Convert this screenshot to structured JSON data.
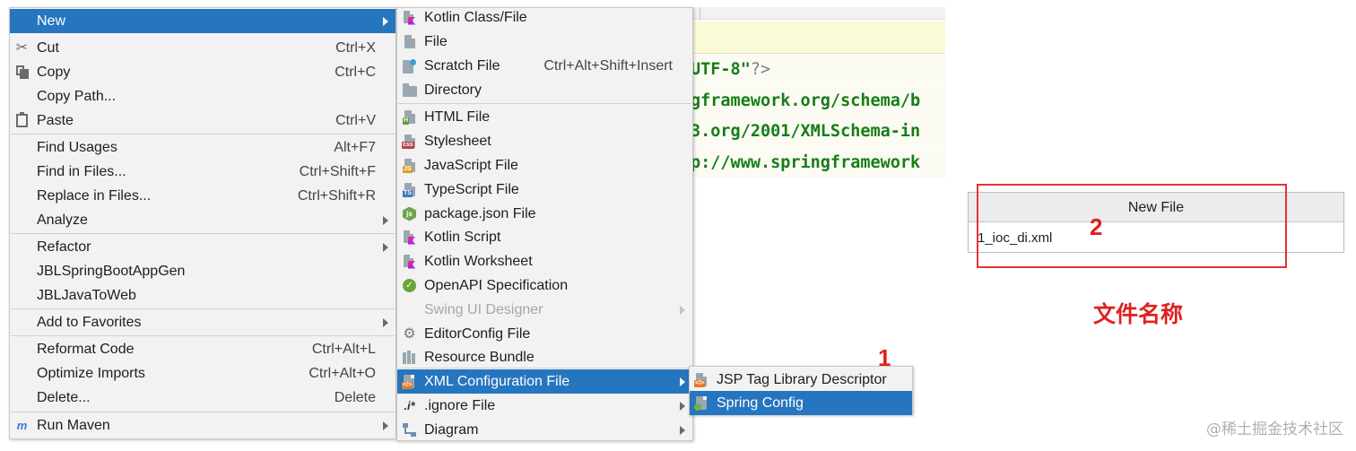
{
  "editor": {
    "lines": [
      {
        "text": "UTF-8\"",
        "tail": "?>"
      },
      {
        "text": "gframework.org/schema/b",
        "tail": ""
      },
      {
        "text": "3.org/2001/XMLSchema-in",
        "tail": ""
      },
      {
        "text": "p://www.springframework",
        "tail": ""
      }
    ]
  },
  "context_menu": {
    "items": [
      {
        "label": "New",
        "shortcut": "",
        "submenu": true,
        "selected": true,
        "icon": ""
      },
      {
        "label": "Cut",
        "shortcut": "Ctrl+X",
        "icon": "scissors-icon"
      },
      {
        "label": "Copy",
        "shortcut": "Ctrl+C",
        "icon": "copy-icon"
      },
      {
        "label": "Copy Path...",
        "shortcut": "",
        "icon": ""
      },
      {
        "label": "Paste",
        "shortcut": "Ctrl+V",
        "icon": "clipboard-icon"
      },
      {
        "label": "Find Usages",
        "shortcut": "Alt+F7",
        "icon": ""
      },
      {
        "label": "Find in Files...",
        "shortcut": "Ctrl+Shift+F",
        "icon": ""
      },
      {
        "label": "Replace in Files...",
        "shortcut": "Ctrl+Shift+R",
        "icon": ""
      },
      {
        "label": "Analyze",
        "shortcut": "",
        "submenu": true,
        "icon": ""
      },
      {
        "label": "Refactor",
        "shortcut": "",
        "submenu": true,
        "icon": ""
      },
      {
        "label": "JBLSpringBootAppGen",
        "shortcut": "",
        "icon": ""
      },
      {
        "label": "JBLJavaToWeb",
        "shortcut": "",
        "icon": ""
      },
      {
        "label": "Add to Favorites",
        "shortcut": "",
        "submenu": true,
        "icon": ""
      },
      {
        "label": "Reformat Code",
        "shortcut": "Ctrl+Alt+L",
        "icon": ""
      },
      {
        "label": "Optimize Imports",
        "shortcut": "Ctrl+Alt+O",
        "icon": ""
      },
      {
        "label": "Delete...",
        "shortcut": "Delete",
        "icon": ""
      },
      {
        "label": "Run Maven",
        "shortcut": "",
        "submenu": true,
        "icon": "maven-icon"
      }
    ]
  },
  "new_menu": {
    "items": [
      {
        "label": "Kotlin Class/File",
        "shortcut": "",
        "icon": "kotlin-icon"
      },
      {
        "label": "File",
        "shortcut": "",
        "icon": "file-icon"
      },
      {
        "label": "Scratch File",
        "shortcut": "Ctrl+Alt+Shift+Insert",
        "icon": "scratch-file-icon"
      },
      {
        "label": "Directory",
        "shortcut": "",
        "icon": "folder-icon"
      },
      {
        "label": "HTML File",
        "shortcut": "",
        "icon": "html-file-icon",
        "badge": "H"
      },
      {
        "label": "Stylesheet",
        "shortcut": "",
        "icon": "css-file-icon",
        "badge": "css"
      },
      {
        "label": "JavaScript File",
        "shortcut": "",
        "icon": "js-file-icon",
        "badge": "JS"
      },
      {
        "label": "TypeScript File",
        "shortcut": "",
        "icon": "ts-file-icon",
        "badge": "TS"
      },
      {
        "label": "package.json File",
        "shortcut": "",
        "icon": "nodejs-icon"
      },
      {
        "label": "Kotlin Script",
        "shortcut": "",
        "icon": "kotlin-script-icon"
      },
      {
        "label": "Kotlin Worksheet",
        "shortcut": "",
        "icon": "kotlin-worksheet-icon"
      },
      {
        "label": "OpenAPI Specification",
        "shortcut": "",
        "icon": "openapi-icon"
      },
      {
        "label": "Swing UI Designer",
        "shortcut": "",
        "submenu": true,
        "disabled": true,
        "icon": ""
      },
      {
        "label": "EditorConfig File",
        "shortcut": "",
        "icon": "gear-icon"
      },
      {
        "label": "Resource Bundle",
        "shortcut": "",
        "icon": "resource-bundle-icon"
      },
      {
        "label": "XML Configuration File",
        "shortcut": "",
        "submenu": true,
        "selected": true,
        "icon": "xml-file-icon"
      },
      {
        "label": ".ignore File",
        "shortcut": "",
        "submenu": true,
        "icon": "ignore-file-icon",
        "glyph": ".i*"
      },
      {
        "label": "Diagram",
        "shortcut": "",
        "submenu": true,
        "icon": "diagram-icon"
      }
    ]
  },
  "xml_menu": {
    "items": [
      {
        "label": "JSP Tag Library Descriptor",
        "icon": "xml-file-icon"
      },
      {
        "label": "Spring Config",
        "icon": "spring-config-icon",
        "selected": true
      }
    ]
  },
  "dialog": {
    "title": "New File",
    "value": "1_ioc_di.xml"
  },
  "annotations": {
    "step1": "1",
    "step2": "2",
    "caption": "文件名称",
    "color": "#e02020"
  },
  "watermark": "@稀土掘金技术社区",
  "colors": {
    "selection": "#2675bf",
    "menu_bg": "#f2f2f2",
    "code_green": "#167d16"
  }
}
